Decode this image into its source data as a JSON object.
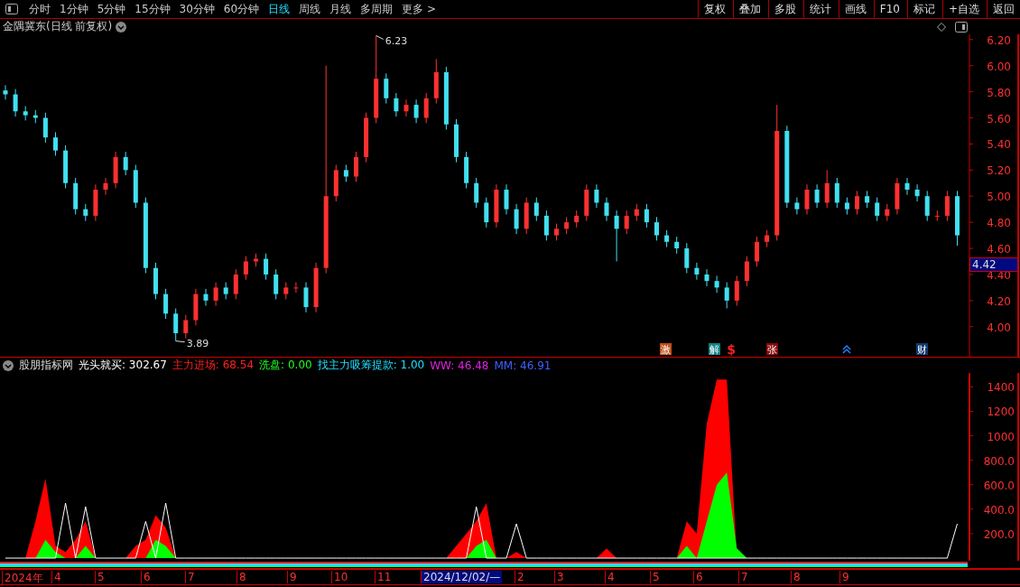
{
  "toolbar": {
    "periods": [
      {
        "label": "分时",
        "selected": false
      },
      {
        "label": "1分钟",
        "selected": false
      },
      {
        "label": "5分钟",
        "selected": false
      },
      {
        "label": "15分钟",
        "selected": false
      },
      {
        "label": "30分钟",
        "selected": false
      },
      {
        "label": "60分钟",
        "selected": false
      },
      {
        "label": "日线",
        "selected": true
      },
      {
        "label": "周线",
        "selected": false
      },
      {
        "label": "月线",
        "selected": false
      },
      {
        "label": "多周期",
        "selected": false
      },
      {
        "label": "更多 >",
        "selected": false
      }
    ],
    "actions": [
      "复权",
      "叠加",
      "多股",
      "统计",
      "画线",
      "F10",
      "标记",
      "+自选",
      "返回"
    ]
  },
  "title": "金隅冀东(日线 前复权)",
  "price_chart": {
    "high_label": "6.23",
    "low_label": "3.89",
    "last_price": "4.42",
    "chart_data": {
      "type": "candlestick",
      "categories": [
        null,
        null,
        null,
        null,
        null,
        null,
        null,
        null,
        null,
        null,
        null,
        null,
        null,
        null,
        null,
        null,
        null,
        null,
        null,
        null,
        null,
        null,
        null,
        null,
        null,
        null,
        null,
        null,
        null,
        null,
        null,
        null,
        null,
        null,
        null,
        null,
        null,
        null,
        null,
        null,
        null,
        null,
        null,
        null,
        null,
        null,
        null,
        null,
        null,
        null,
        null,
        null,
        null,
        null,
        null,
        null,
        null,
        null,
        null,
        null,
        null,
        null,
        null,
        null,
        null,
        null,
        null,
        null,
        null,
        null,
        null,
        null,
        null,
        null,
        null,
        null,
        null,
        null,
        null,
        null,
        null,
        null,
        null,
        null,
        null,
        null,
        null,
        null,
        null,
        null,
        null,
        null,
        null,
        null,
        null,
        null
      ],
      "ylim": [
        3.77,
        6.24
      ],
      "yticks": [
        {
          "value": 4.0,
          "label": "4.00"
        },
        {
          "value": 4.2,
          "label": "4.20"
        },
        {
          "value": 4.4,
          "label": "4.40"
        },
        {
          "value": 4.6,
          "label": "4.60"
        },
        {
          "value": 4.8,
          "label": "4.80"
        },
        {
          "value": 5.0,
          "label": "5.00"
        },
        {
          "value": 5.2,
          "label": "5.20"
        },
        {
          "value": 5.4,
          "label": "5.40"
        },
        {
          "value": 5.6,
          "label": "5.60"
        },
        {
          "value": 5.8,
          "label": "5.80"
        },
        {
          "value": 6.0,
          "label": "6.00"
        },
        {
          "value": 6.2,
          "label": "6.20"
        }
      ],
      "ohlc": [
        [
          5.81,
          5.85,
          5.74,
          5.78
        ],
        [
          5.78,
          5.82,
          5.61,
          5.65
        ],
        [
          5.65,
          5.69,
          5.58,
          5.62
        ],
        [
          5.62,
          5.66,
          5.56,
          5.6
        ],
        [
          5.6,
          5.64,
          5.41,
          5.45
        ],
        [
          5.45,
          5.49,
          5.31,
          5.35
        ],
        [
          5.35,
          5.39,
          5.06,
          5.1
        ],
        [
          5.1,
          5.14,
          4.86,
          4.9
        ],
        [
          4.9,
          4.94,
          4.81,
          4.85
        ],
        [
          4.85,
          5.09,
          4.81,
          5.05
        ],
        [
          5.05,
          5.14,
          5.01,
          5.1
        ],
        [
          5.1,
          5.34,
          5.06,
          5.3
        ],
        [
          5.3,
          5.34,
          5.16,
          5.2
        ],
        [
          5.2,
          5.24,
          4.91,
          4.95
        ],
        [
          4.95,
          4.99,
          4.41,
          4.45
        ],
        [
          4.45,
          4.49,
          4.21,
          4.25
        ],
        [
          4.25,
          4.29,
          4.06,
          4.1
        ],
        [
          4.1,
          4.14,
          3.89,
          3.95
        ],
        [
          3.95,
          4.09,
          3.91,
          4.05
        ],
        [
          4.05,
          4.29,
          4.01,
          4.25
        ],
        [
          4.25,
          4.29,
          4.16,
          4.2
        ],
        [
          4.2,
          4.34,
          4.16,
          4.3
        ],
        [
          4.3,
          4.34,
          4.21,
          4.25
        ],
        [
          4.25,
          4.44,
          4.21,
          4.4
        ],
        [
          4.4,
          4.54,
          4.36,
          4.5
        ],
        [
          4.5,
          4.56,
          4.46,
          4.52
        ],
        [
          4.52,
          4.56,
          4.36,
          4.4
        ],
        [
          4.4,
          4.44,
          4.21,
          4.25
        ],
        [
          4.25,
          4.34,
          4.21,
          4.3
        ],
        [
          4.3,
          4.34,
          4.26,
          4.3
        ],
        [
          4.3,
          4.34,
          4.11,
          4.15
        ],
        [
          4.15,
          4.49,
          4.11,
          4.45
        ],
        [
          4.45,
          6.0,
          4.41,
          5.0
        ],
        [
          5.0,
          5.24,
          4.96,
          5.2
        ],
        [
          5.2,
          5.24,
          5.11,
          5.15
        ],
        [
          5.15,
          5.34,
          5.11,
          5.3
        ],
        [
          5.3,
          5.64,
          5.26,
          5.6
        ],
        [
          5.6,
          6.23,
          5.56,
          5.9
        ],
        [
          5.9,
          5.94,
          5.71,
          5.75
        ],
        [
          5.75,
          5.79,
          5.61,
          5.65
        ],
        [
          5.65,
          5.74,
          5.61,
          5.7
        ],
        [
          5.7,
          5.74,
          5.56,
          5.6
        ],
        [
          5.6,
          5.79,
          5.56,
          5.75
        ],
        [
          5.75,
          6.05,
          5.71,
          5.95
        ],
        [
          5.95,
          5.99,
          5.51,
          5.55
        ],
        [
          5.55,
          5.59,
          5.26,
          5.3
        ],
        [
          5.3,
          5.34,
          5.06,
          5.1
        ],
        [
          5.1,
          5.14,
          4.91,
          4.95
        ],
        [
          4.95,
          4.99,
          4.76,
          4.8
        ],
        [
          4.8,
          5.09,
          4.76,
          5.05
        ],
        [
          5.05,
          5.09,
          4.86,
          4.9
        ],
        [
          4.9,
          4.94,
          4.71,
          4.75
        ],
        [
          4.75,
          4.99,
          4.71,
          4.95
        ],
        [
          4.95,
          4.99,
          4.81,
          4.85
        ],
        [
          4.85,
          4.89,
          4.66,
          4.7
        ],
        [
          4.7,
          4.79,
          4.66,
          4.75
        ],
        [
          4.75,
          4.84,
          4.71,
          4.8
        ],
        [
          4.8,
          4.89,
          4.76,
          4.85
        ],
        [
          4.85,
          5.09,
          4.81,
          5.05
        ],
        [
          5.05,
          5.09,
          4.91,
          4.95
        ],
        [
          4.95,
          4.99,
          4.81,
          4.85
        ],
        [
          4.85,
          4.89,
          4.5,
          4.75
        ],
        [
          4.75,
          4.89,
          4.71,
          4.85
        ],
        [
          4.85,
          4.94,
          4.81,
          4.9
        ],
        [
          4.9,
          4.94,
          4.76,
          4.8
        ],
        [
          4.8,
          4.84,
          4.66,
          4.7
        ],
        [
          4.7,
          4.74,
          4.61,
          4.65
        ],
        [
          4.65,
          4.69,
          4.56,
          4.6
        ],
        [
          4.6,
          4.64,
          4.41,
          4.45
        ],
        [
          4.45,
          4.49,
          4.36,
          4.4
        ],
        [
          4.4,
          4.44,
          4.31,
          4.35
        ],
        [
          4.35,
          4.39,
          4.26,
          4.3
        ],
        [
          4.3,
          4.34,
          4.14,
          4.2
        ],
        [
          4.2,
          4.39,
          4.16,
          4.35
        ],
        [
          4.35,
          4.54,
          4.31,
          4.5
        ],
        [
          4.5,
          4.69,
          4.46,
          4.65
        ],
        [
          4.65,
          4.74,
          4.61,
          4.7
        ],
        [
          4.7,
          5.7,
          4.66,
          5.5
        ],
        [
          5.5,
          5.54,
          4.91,
          4.95
        ],
        [
          4.95,
          4.99,
          4.86,
          4.9
        ],
        [
          4.9,
          5.09,
          4.86,
          5.05
        ],
        [
          5.05,
          5.09,
          4.91,
          4.95
        ],
        [
          4.95,
          5.2,
          4.91,
          5.1
        ],
        [
          5.1,
          5.14,
          4.91,
          4.95
        ],
        [
          4.95,
          4.99,
          4.86,
          4.9
        ],
        [
          4.9,
          5.04,
          4.86,
          5.0
        ],
        [
          5.0,
          5.04,
          4.91,
          4.95
        ],
        [
          4.95,
          4.99,
          4.81,
          4.85
        ],
        [
          4.85,
          4.94,
          4.81,
          4.9
        ],
        [
          4.9,
          5.14,
          4.86,
          5.1
        ],
        [
          5.1,
          5.14,
          5.01,
          5.05
        ],
        [
          5.05,
          5.09,
          4.96,
          5.0
        ],
        [
          5.0,
          5.04,
          4.81,
          4.85
        ],
        [
          4.85,
          4.89,
          4.81,
          4.85
        ],
        [
          4.85,
          5.04,
          4.81,
          5.0
        ],
        [
          5.0,
          5.04,
          4.62,
          4.7
        ]
      ]
    }
  },
  "signals": [
    {
      "kind": "tag",
      "label": "激",
      "color": "#c05018"
    },
    {
      "kind": "tag",
      "label": "解",
      "color": "#128080"
    },
    {
      "kind": "glyph",
      "label": "$",
      "color": "#ff2020"
    },
    {
      "kind": "tag",
      "label": "张",
      "color": "#8a0808"
    },
    {
      "kind": "arrow",
      "color": "#2080ff"
    },
    {
      "kind": "tag",
      "label": "财",
      "color": "#103a70"
    }
  ],
  "indicator": {
    "name": "股朋指标网",
    "readings": [
      {
        "text": "光头就买: 302.67",
        "color": "#ffffff"
      },
      {
        "text": "主力进场: 68.54",
        "color": "#ff2020"
      },
      {
        "text": "洗盘: 0.00",
        "color": "#20ff20"
      },
      {
        "text": "找主力吸筹提款: 1.00",
        "color": "#20e0ff"
      },
      {
        "text": "WW: 46.48",
        "color": "#e020e0"
      },
      {
        "text": "MM: 46.91",
        "color": "#4060ff"
      }
    ],
    "chart_data": {
      "type": "area",
      "ylim": [
        0,
        1513
      ],
      "yticks": [
        {
          "value": 200,
          "label": "200.0"
        },
        {
          "value": 400,
          "label": "400.0"
        },
        {
          "value": 600,
          "label": "600.0"
        },
        {
          "value": 800,
          "label": "800.0"
        },
        {
          "value": 1000,
          "label": "1000"
        },
        {
          "value": 1200,
          "label": "1200"
        },
        {
          "value": 1400,
          "label": "1400"
        }
      ],
      "series": [
        {
          "type": "area",
          "color": "#ff0000",
          "values": [
            0,
            0,
            0,
            300,
            650,
            100,
            50,
            150,
            300,
            0,
            0,
            0,
            0,
            100,
            150,
            350,
            250,
            0,
            0,
            0,
            0,
            0,
            0,
            0,
            0,
            0,
            0,
            0,
            0,
            0,
            0,
            0,
            0,
            0,
            0,
            0,
            0,
            0,
            0,
            0,
            0,
            0,
            0,
            0,
            0,
            100,
            200,
            300,
            450,
            0,
            0,
            50,
            0,
            0,
            0,
            0,
            0,
            0,
            0,
            0,
            80,
            0,
            0,
            0,
            0,
            0,
            0,
            0,
            300,
            200,
            1100,
            1460,
            1460,
            0,
            0,
            0,
            0,
            0,
            0,
            0,
            0,
            0,
            0,
            0,
            0,
            0,
            0,
            0,
            0,
            0,
            0,
            0,
            0,
            0,
            0,
            0
          ]
        },
        {
          "type": "area",
          "color": "#00ff00",
          "values": [
            0,
            0,
            0,
            0,
            150,
            50,
            0,
            0,
            100,
            0,
            0,
            0,
            0,
            0,
            0,
            150,
            100,
            0,
            0,
            0,
            0,
            0,
            0,
            0,
            0,
            0,
            0,
            0,
            0,
            0,
            0,
            0,
            0,
            0,
            0,
            0,
            0,
            0,
            0,
            0,
            0,
            0,
            0,
            0,
            0,
            0,
            0,
            100,
            150,
            0,
            0,
            0,
            0,
            0,
            0,
            0,
            0,
            0,
            0,
            0,
            0,
            0,
            0,
            0,
            0,
            0,
            0,
            0,
            100,
            0,
            300,
            600,
            700,
            80,
            0,
            0,
            0,
            0,
            0,
            0,
            0,
            0,
            0,
            0,
            0,
            0,
            0,
            0,
            0,
            0,
            0,
            0,
            0,
            0,
            0,
            0
          ]
        },
        {
          "type": "line",
          "color": "#ffffff",
          "values": [
            0,
            0,
            0,
            0,
            0,
            0,
            450,
            0,
            420,
            0,
            0,
            0,
            0,
            0,
            300,
            0,
            450,
            0,
            0,
            0,
            0,
            0,
            0,
            0,
            0,
            0,
            0,
            0,
            0,
            0,
            0,
            0,
            0,
            0,
            0,
            0,
            0,
            0,
            0,
            0,
            0,
            0,
            0,
            0,
            0,
            0,
            0,
            420,
            0,
            0,
            0,
            280,
            0,
            0,
            0,
            0,
            0,
            0,
            0,
            0,
            0,
            0,
            0,
            0,
            0,
            0,
            0,
            0,
            0,
            0,
            0,
            0,
            0,
            0,
            0,
            0,
            0,
            0,
            0,
            0,
            0,
            0,
            0,
            0,
            0,
            0,
            0,
            0,
            0,
            0,
            0,
            0,
            0,
            0,
            0,
            280
          ]
        }
      ]
    }
  },
  "date_axis": [
    {
      "label": "2024年",
      "selected": false
    },
    {
      "label": "4",
      "selected": false
    },
    {
      "label": "5",
      "selected": false
    },
    {
      "label": "6",
      "selected": false
    },
    {
      "label": "7",
      "selected": false
    },
    {
      "label": "8",
      "selected": false
    },
    {
      "label": "9",
      "selected": false
    },
    {
      "label": "10",
      "selected": false
    },
    {
      "label": "11",
      "selected": false
    },
    {
      "label": "2024/12/02/—",
      "selected": true
    },
    {
      "label": "2",
      "selected": false
    },
    {
      "label": "3",
      "selected": false
    },
    {
      "label": "4",
      "selected": false
    },
    {
      "label": "5",
      "selected": false
    },
    {
      "label": "6",
      "selected": false
    },
    {
      "label": "7",
      "selected": false
    },
    {
      "label": "8",
      "selected": false
    },
    {
      "label": "9",
      "selected": false
    }
  ]
}
